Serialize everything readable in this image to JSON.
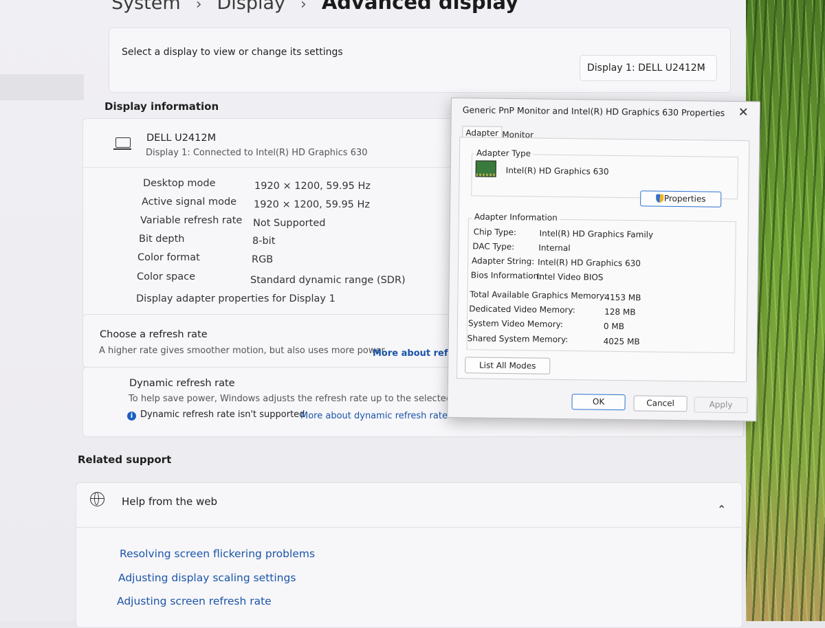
{
  "breadcrumb": [
    "System",
    "Display",
    "Advanced display"
  ],
  "display_select": {
    "prompt": "Select a display to view or change its settings",
    "selected": "Display 1: DELL U2412M"
  },
  "display_info": {
    "section_title": "Display information",
    "monitor_name": "DELL U2412M",
    "monitor_subtitle": "Display 1: Connected to Intel(R) HD Graphics 630",
    "rows": [
      {
        "label": "Desktop mode",
        "value": "1920 × 1200, 59.95 Hz"
      },
      {
        "label": "Active signal mode",
        "value": "1920 × 1200, 59.95 Hz"
      },
      {
        "label": "Variable refresh rate",
        "value": "Not Supported"
      },
      {
        "label": "Bit depth",
        "value": "8-bit"
      },
      {
        "label": "Color format",
        "value": "RGB"
      },
      {
        "label": "Color space",
        "value": "Standard dynamic range (SDR)"
      }
    ],
    "adapter_link": "Display adapter properties for Display 1"
  },
  "refresh": {
    "title": "Choose a refresh rate",
    "desc": "A higher rate gives smoother motion, but also uses more power",
    "link": "More about refres"
  },
  "dynamic": {
    "title": "Dynamic refresh rate",
    "desc": "To help save power, Windows adjusts the refresh rate up to the selected rate",
    "notice": "Dynamic refresh rate isn't supported",
    "link": "More about dynamic refresh rate"
  },
  "related": {
    "title": "Related support",
    "help_title": "Help from the web",
    "links": [
      "Resolving screen flickering problems",
      "Adjusting display scaling settings",
      "Adjusting screen refresh rate"
    ]
  },
  "dialog": {
    "title": "Generic PnP Monitor and Intel(R) HD Graphics 630 Properties",
    "tabs": [
      "Adapter",
      "Monitor"
    ],
    "adapter_type_label": "Adapter Type",
    "adapter_name": "Intel(R) HD Graphics 630",
    "properties_button": "Properties",
    "adapter_info_label": "Adapter Information",
    "info_rows": [
      {
        "label": "Chip Type:",
        "value": "Intel(R) HD Graphics Family"
      },
      {
        "label": "DAC Type:",
        "value": "Internal"
      },
      {
        "label": "Adapter String:",
        "value": "Intel(R) HD Graphics 630"
      },
      {
        "label": "Bios Information:",
        "value": "Intel Video BIOS"
      }
    ],
    "memory_rows": [
      {
        "label": "Total Available Graphics Memory:",
        "value": "4153 MB"
      },
      {
        "label": "Dedicated Video Memory:",
        "value": "128 MB"
      },
      {
        "label": "System Video Memory:",
        "value": "0 MB"
      },
      {
        "label": "Shared System Memory:",
        "value": "4025 MB"
      }
    ],
    "list_modes_button": "List All Modes",
    "ok": "OK",
    "cancel": "Cancel",
    "apply": "Apply"
  }
}
